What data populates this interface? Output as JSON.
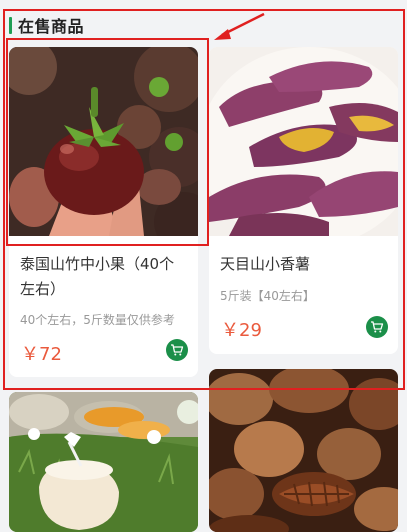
{
  "section": {
    "title": "在售商品"
  },
  "products": [
    {
      "title": "泰国山竹中小果（40个左右）",
      "desc": "40个左右，5斤数量仅供参考",
      "price": "￥72",
      "image": "mangosteen-photo"
    },
    {
      "title": "天目山小香薯",
      "desc": "5斤装【40左右】",
      "price": "￥29",
      "image": "sweet-potato-photo"
    },
    {
      "title": "",
      "desc": "",
      "price": "",
      "image": "coconut-photo"
    },
    {
      "title": "",
      "desc": "",
      "price": "",
      "image": "pecan-photo"
    }
  ],
  "icons": {
    "cart": "cart-icon",
    "arrow": "annotation-arrow-icon"
  },
  "colors": {
    "accent": "#1b8f49",
    "price": "#ea5a3d",
    "highlight": "#e02020"
  }
}
